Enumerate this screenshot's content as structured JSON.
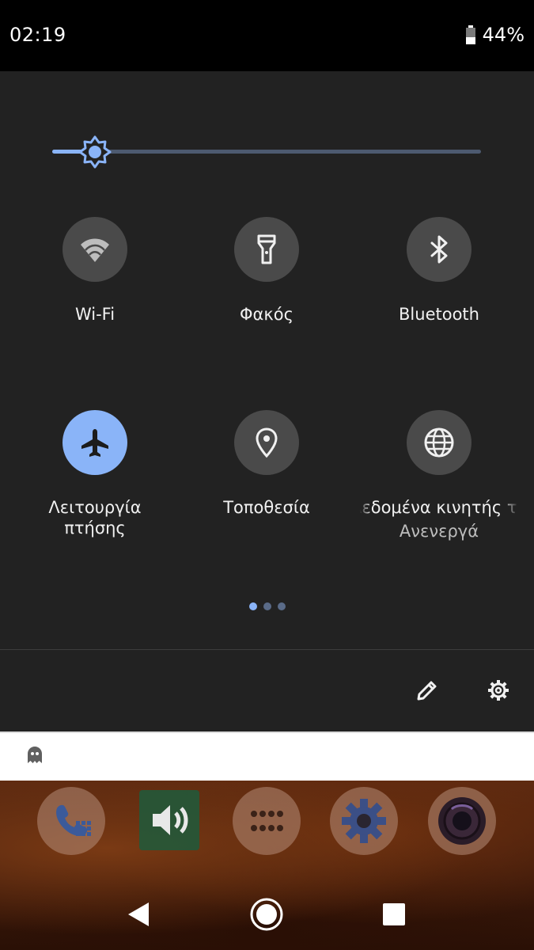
{
  "status_bar": {
    "time": "02:19",
    "battery_percent_text": "44%",
    "battery_level": 0.44
  },
  "brightness": {
    "level": 0.1
  },
  "tiles": [
    {
      "id": "wifi",
      "label": "Wi-Fi",
      "icon": "wifi-icon",
      "active": false
    },
    {
      "id": "flashlight",
      "label": "Φακός",
      "icon": "flashlight-icon",
      "active": false
    },
    {
      "id": "bluetooth",
      "label": "Bluetooth",
      "icon": "bluetooth-icon",
      "active": false
    },
    {
      "id": "airplane",
      "label": "Λειτουργία πτήσης",
      "icon": "airplane-icon",
      "active": true
    },
    {
      "id": "location",
      "label": "Τοποθεσία",
      "icon": "location-pin-icon",
      "active": false
    },
    {
      "id": "mobile_data",
      "label": "Δεδομένα κινητής τηλεφωνίας",
      "sublabel": "Ανενεργά",
      "icon": "globe-icon",
      "active": false
    }
  ],
  "page_indicator": {
    "count": 3,
    "active": 0
  },
  "footer": {
    "edit_icon": "pencil-icon",
    "settings_icon": "gear-icon"
  },
  "notification": {
    "icon": "ghost-icon"
  },
  "dock": [
    "phone-app-icon",
    "volume-app-icon",
    "app-drawer-icon",
    "settings-app-icon",
    "camera-app-icon"
  ],
  "nav": [
    "back-icon",
    "home-icon",
    "recents-icon"
  ],
  "colors": {
    "panel_bg": "#222222",
    "accent": "#8ab4f8",
    "tile_inactive": "#4a4a4a"
  }
}
